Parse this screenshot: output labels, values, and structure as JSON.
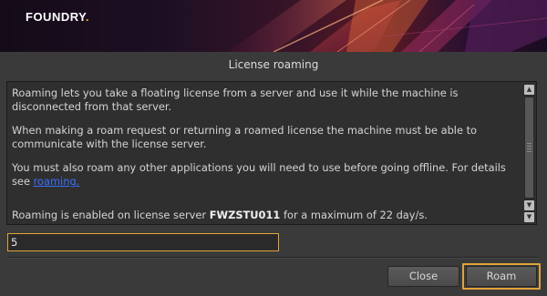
{
  "brand": {
    "name": "FOUNDRY",
    "dot": "."
  },
  "dialog": {
    "title": "License roaming"
  },
  "info": {
    "para1": "Roaming lets you take a floating license from a server and use it while the machine is disconnected from that server.",
    "para2": "When making a roam request or returning a roamed license the machine must be able to communicate with the license server.",
    "para3_prefix": "You must also roam any other applications you will need to use before going offline. For details see ",
    "para3_link": "roaming.",
    "para4_prefix": "Roaming is enabled on license server ",
    "para4_server": "FWZSTU011",
    "para4_suffix": " for a maximum of 22 day/s."
  },
  "roam_days_input": {
    "value": "5"
  },
  "buttons": {
    "close": "Close",
    "roam": "Roam"
  },
  "colors": {
    "accent": "#e0a33a",
    "link": "#3b6fff",
    "brand_dot": "#f5a623"
  },
  "icons": {
    "scroll_up": "triangle-up",
    "scroll_down": "triangle-down"
  }
}
